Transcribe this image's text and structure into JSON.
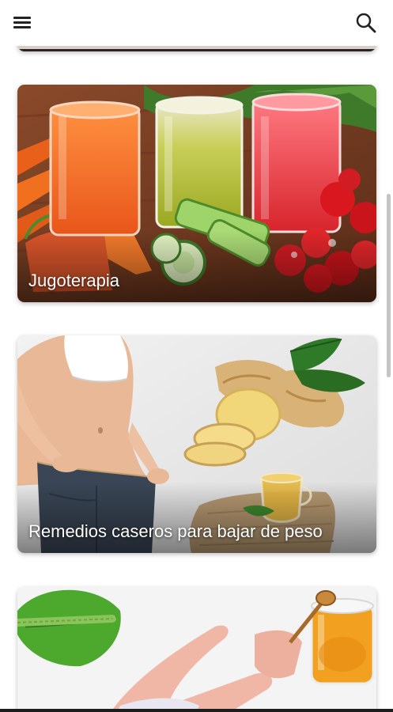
{
  "app_bar": {
    "menu_icon": "hamburger-menu-icon",
    "search_icon": "search-icon"
  },
  "cards": [
    {
      "title": "Jugoterapia",
      "image": "juices-vegetables-photo"
    },
    {
      "title": "Remedios caseros para bajar de peso",
      "image": "weight-loss-ginger-photo"
    },
    {
      "title": "",
      "image": "plantain-leaf-honey-photo"
    }
  ],
  "colors": {
    "background": "#ffffff",
    "title_text": "#ffffff",
    "icon": "#222222"
  }
}
